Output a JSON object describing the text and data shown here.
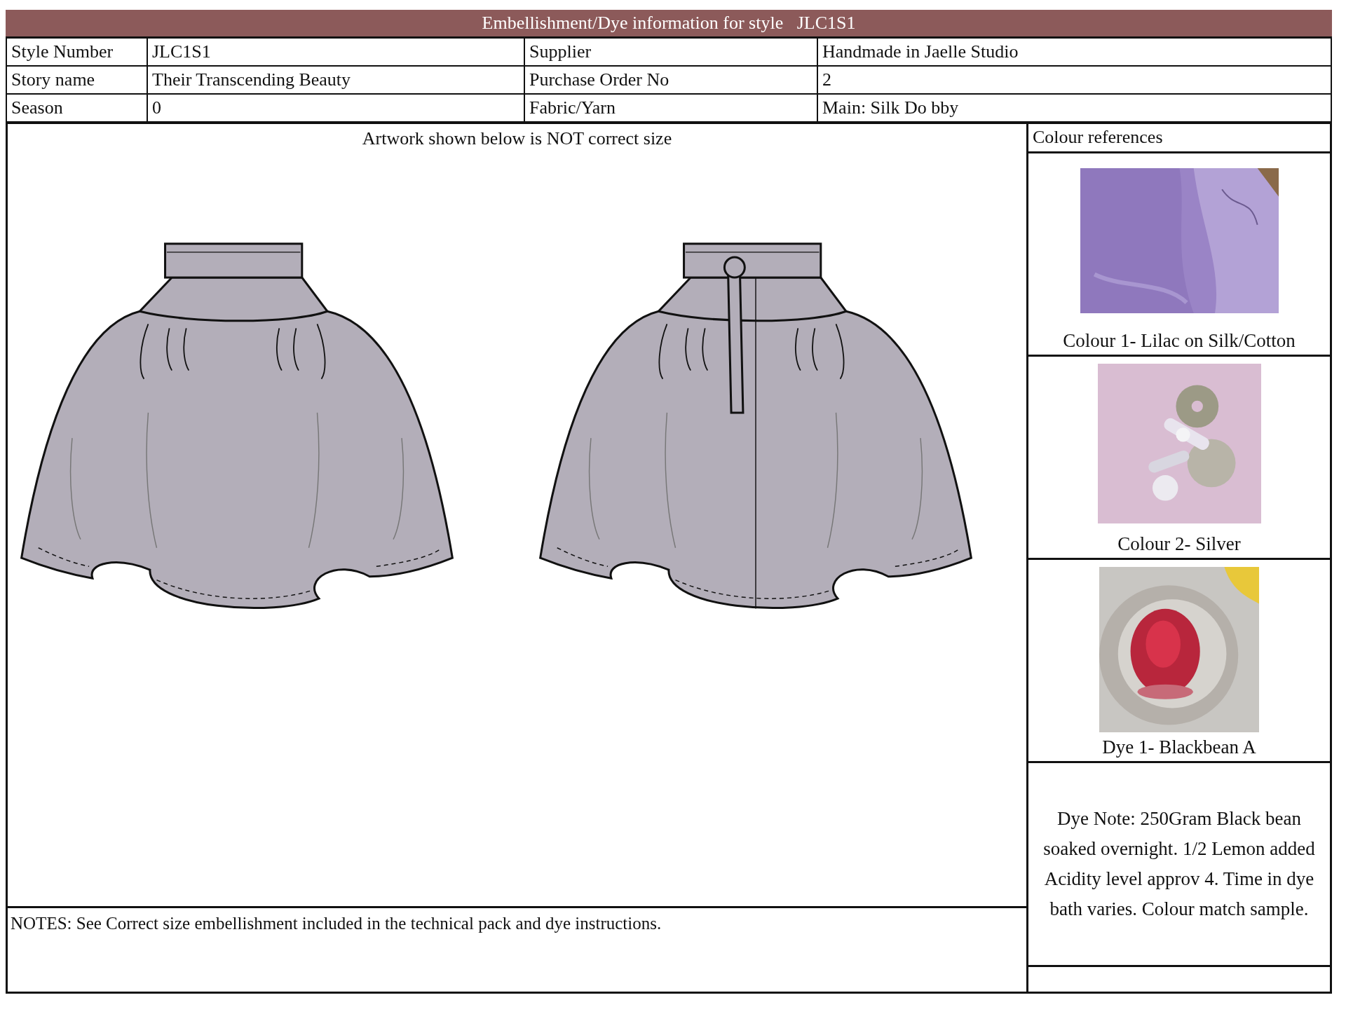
{
  "title": {
    "label": "Embellishment/Dye information for style",
    "style": "JLC1S1"
  },
  "info_rows": [
    {
      "label": "Style Number",
      "value": "JLC1S1",
      "label_2": "Supplier",
      "value_2": "Handmade in Jaelle Studio"
    },
    {
      "label": "Story name",
      "value": "Their Transcending Beauty",
      "label_2": "Purchase Order No",
      "value_2": "2"
    },
    {
      "label": "Season",
      "value": "0",
      "label_2": "Fabric/Yarn",
      "value_2": "Main: Silk Do bby"
    }
  ],
  "artwork": {
    "heading": "Artwork shown below is NOT correct size",
    "views": [
      {
        "kind": "front"
      },
      {
        "kind": "back"
      }
    ]
  },
  "notes": "NOTES: See Correct size embellishment included in the technical pack and dye instructions.",
  "colour_references": {
    "heading": "Colour references",
    "swatches": [
      {
        "kind": "picture",
        "caption": "Colour 1- Lilac on Silk/Cotton"
      },
      {
        "kind": "picture",
        "caption": "Colour 2- Silver"
      },
      {
        "kind": "picture",
        "caption": "Dye 1- Blackbean A"
      }
    ]
  },
  "dye_note": "Dye Note: 250Gram Black bean soaked overnight. 1/2 Lemon added Acidity level approv 4. Time in dye bath varies. Colour match sample."
}
